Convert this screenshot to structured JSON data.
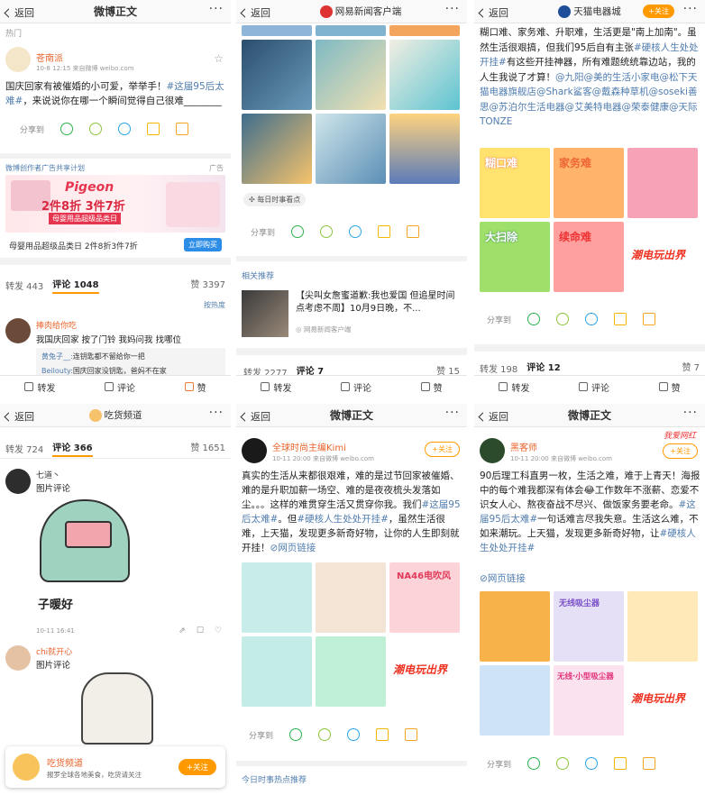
{
  "common": {
    "back": "返回",
    "forward": "转发",
    "comment": "评论",
    "like": "赞",
    "share_to": "分享到"
  },
  "p1": {
    "title": "微博正文",
    "section": "热门",
    "user": "苍南派",
    "time": "10-8 12:15",
    "source": "来自微博 weibo.com",
    "text1": "国庆回家有被催婚的小可爱，举举手！",
    "tag": "#这届95后太难#",
    "text2": "，来说说你在哪一个瞬间觉得自己很难________",
    "ad_plan": "微博创作者广告共享计划",
    "ad_label": "广告",
    "ad_brand": "Pigeon",
    "ad_big": "2件8折 3件7折",
    "ad_cat": "母婴用品超级品类日",
    "ad_desc": "母婴用品超级品类日 2件8折3件7折",
    "ad_btn": "立即购买",
    "repost": "转发 443",
    "comments": "评论 1048",
    "likes": "赞 3397",
    "sort": "按热度",
    "c_user": "捧肉给你吃",
    "c_text": "我国庆回家 按了门铃 我妈问我 找哪位",
    "r1_user": "黄兔子__:",
    "r1_text": "连钥匙都不留给你一把",
    "r2_user": "Beilouty:",
    "r2_text": "国庆回家没钥匙，爸妈不在家"
  },
  "p2": {
    "title": "网易新闻客户端",
    "tag_label": "每日时事看点",
    "rel_title": "相关推荐",
    "news": "【尖叫女詹蜜道歉:我也爱国 但追星时间点考虑不周】10月9日晚，不...",
    "news_src": "网易新闻客户端",
    "repost": "转发 2277",
    "comments": "评论 7",
    "likes": "赞 15"
  },
  "p3": {
    "title": "天猫电器城",
    "follow": "+关注",
    "text": "糊口难、家务难、升职难，生活更是\"南上加南\"。虽然生活很艰搞，但我们95后自有主张",
    "tag1": "#硬核人生处处开挂#",
    "text2": "有这些开挂神器，所有难题统统靠边站，我的人生我说了才算！",
    "mentions": "@九阳@美的生活小家电@松下天猫电器旗舰店@Shark鲨客@戴森种草机@soseki善思@苏泊尔生活电器@艾美特电器@荣泰健康@天际TONZE",
    "img_labels": [
      "糊口难",
      "家务难",
      "",
      "大扫除",
      "续命难",
      "潮电玩出界"
    ],
    "repost": "转发 198",
    "comments": "评论 12",
    "likes": "赞 7"
  },
  "p4": {
    "title": "吃货频道",
    "repost": "转发 724",
    "comments": "评论 366",
    "likes": "赞 1651",
    "u1": "七道丶",
    "u1_text": "图片评论",
    "u1_time": "10-11 16:41",
    "caption": "子暖好",
    "u2": "chi就开心",
    "u2_text": "图片评论",
    "banner_name": "吃货频道",
    "banner_desc": "报罗全球各地美食，吃货请关注",
    "banner_btn": "+关注"
  },
  "p5": {
    "title": "微博正文",
    "user": "全球时尚主编Kimi",
    "time": "10-11 20:00",
    "source": "来自微博 weibo.com",
    "follow": "+关注",
    "text1": "真实的生活从来都很艰难，难的是过节回家被催婚、难的是升职加薪一场空、难的是夜夜梳头发落如尘。。。这样的难贯穿生活又贯穿你我。我们",
    "tag1": "#这届95后太难#",
    "text2": "。但",
    "tag2": "#硬核人生处处开挂#",
    "text3": "，虽然生活很难，上天猫，发现更多新奇好物，让你的人生即刻就开挂！",
    "link": "网页链接",
    "img_labels": [
      "",
      "",
      "NA46电吹风",
      "",
      "",
      "潮电玩出界"
    ],
    "hot": "今日时事热点推荐"
  },
  "p6": {
    "title": "微博正文",
    "watermark": "我爱网红",
    "user": "黑客师",
    "time": "10-11 20:00",
    "source": "来自微博 weibo.com",
    "follow": "+关注",
    "text1": "90后理工科直男一枚，生活之难，难于上青天！海报中的每个难我都深有体会😂工作数年不涨薪、恋爱不识女人心、熬夜奋战不尽兴、做饭家务要老命。",
    "tag1": "#这届95后太难#",
    "text2": "一句话难言尽我失意。生活这么难，不如来潮玩。上天猫，发现更多新奇好物，让",
    "tag2": "#硬核人生处处开挂#",
    "link": "网页链接",
    "img_labels": [
      "",
      "无线吸尘器",
      "",
      "",
      "无线·小型吸尘器",
      "潮电玩出界"
    ]
  }
}
